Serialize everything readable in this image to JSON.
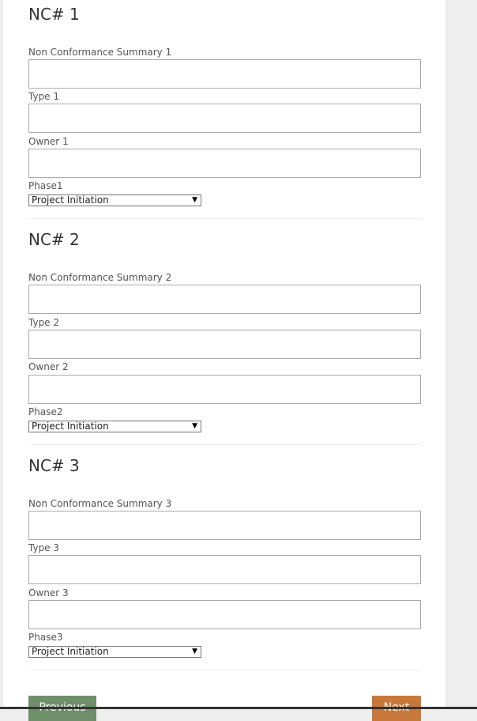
{
  "sections": [
    {
      "title": "NC# 1",
      "summary_label": "Non Conformance Summary 1",
      "summary_value": "",
      "type_label": "Type 1",
      "type_value": "",
      "owner_label": "Owner 1",
      "owner_value": "",
      "phase_label": "Phase1",
      "phase_selected": "Project Initiation"
    },
    {
      "title": "NC# 2",
      "summary_label": "Non Conformance Summary 2",
      "summary_value": "",
      "type_label": "Type 2",
      "type_value": "",
      "owner_label": "Owner 2",
      "owner_value": "",
      "phase_label": "Phase2",
      "phase_selected": "Project Initiation"
    },
    {
      "title": "NC# 3",
      "summary_label": "Non Conformance Summary 3",
      "summary_value": "",
      "type_label": "Type 3",
      "type_value": "",
      "owner_label": "Owner 3",
      "owner_value": "",
      "phase_label": "Phase3",
      "phase_selected": "Project Initiation"
    }
  ],
  "icons": {
    "select_caret": "▼"
  },
  "buttons": {
    "previous_label": "Previous",
    "next_label": "Next"
  },
  "colors": {
    "previous_button": "#6f8f6a",
    "next_button": "#c8783a"
  }
}
